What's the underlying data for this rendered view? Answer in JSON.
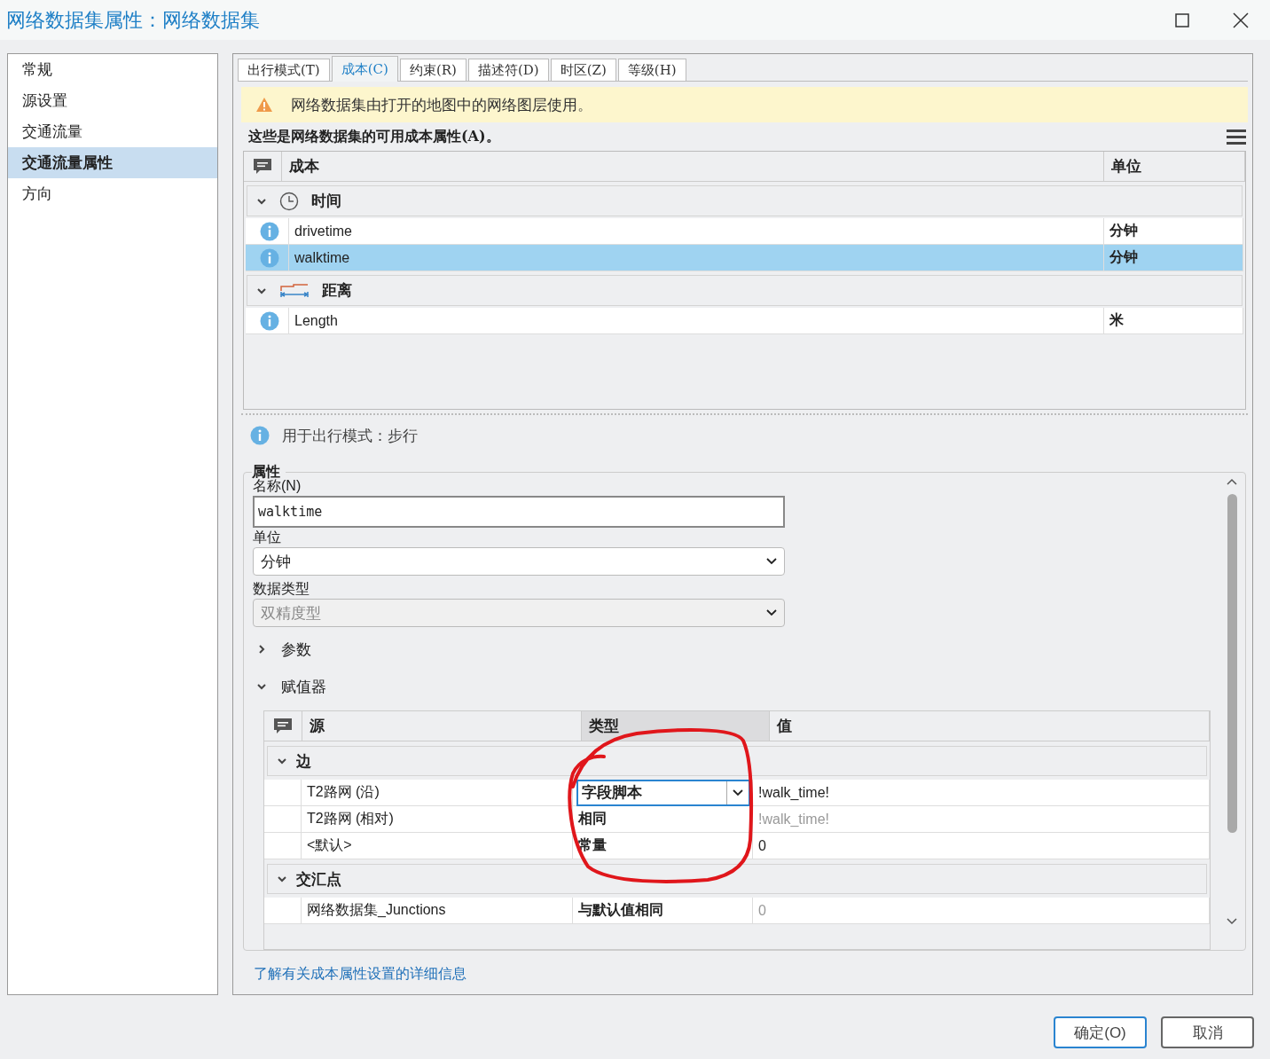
{
  "window": {
    "title": "网络数据集属性：网络数据集"
  },
  "sidebar": {
    "items": [
      {
        "label": "常规",
        "selected": false
      },
      {
        "label": "源设置",
        "selected": false
      },
      {
        "label": "交通流量",
        "selected": false
      },
      {
        "label": "交通流量属性",
        "selected": true
      },
      {
        "label": "方向",
        "selected": false
      }
    ]
  },
  "tabs": [
    {
      "label": "出行模式(T)",
      "selected": false
    },
    {
      "label": "成本(C)",
      "selected": true
    },
    {
      "label": "约束(R)",
      "selected": false
    },
    {
      "label": "描述符(D)",
      "selected": false
    },
    {
      "label": "时区(Z)",
      "selected": false
    },
    {
      "label": "等级(H)",
      "selected": false
    }
  ],
  "warning": "网络数据集由打开的地图中的网络图层使用。",
  "cost_caption": "这些是网络数据集的可用成本属性(A)。",
  "cost_table": {
    "columns": [
      "成本",
      "单位"
    ],
    "groups": [
      {
        "name": "时间",
        "kind": "time",
        "expanded": true,
        "rows": [
          {
            "name": "drivetime",
            "unit": "分钟",
            "selected": false
          },
          {
            "name": "walktime",
            "unit": "分钟",
            "selected": true
          }
        ]
      },
      {
        "name": "距离",
        "kind": "distance",
        "expanded": true,
        "rows": [
          {
            "name": "Length",
            "unit": "米",
            "selected": false
          }
        ]
      }
    ]
  },
  "usage_note": "用于出行模式：步行",
  "properties": {
    "legend": "属性",
    "name_label": "名称(N)",
    "name_value": "walktime",
    "unit_label": "单位",
    "unit_value": "分钟",
    "data_type_label": "数据类型",
    "data_type_value": "双精度型",
    "data_type_disabled": true,
    "sections": [
      {
        "label": "参数",
        "expanded": false
      },
      {
        "label": "赋值器",
        "expanded": true
      }
    ]
  },
  "evaluators": {
    "columns": [
      "源",
      "类型",
      "值"
    ],
    "groups": [
      {
        "name": "边",
        "expanded": true,
        "rows": [
          {
            "source": "T2路网 (沿)",
            "type": "字段脚本",
            "value": "!walk_time!",
            "editing": true,
            "inherited": false
          },
          {
            "source": "T2路网 (相对)",
            "type": "相同",
            "value": "!walk_time!",
            "editing": false,
            "inherited": true
          },
          {
            "source": "<默认>",
            "type": "常量",
            "value": "0",
            "editing": false,
            "inherited": false
          }
        ]
      },
      {
        "name": "交汇点",
        "expanded": true,
        "rows": [
          {
            "source": "网络数据集_Junctions",
            "type": "与默认值相同",
            "value": "0",
            "editing": false,
            "inherited": true
          }
        ]
      }
    ]
  },
  "help_link": "了解有关成本属性设置的详细信息",
  "buttons": [
    {
      "label": "确定(O)",
      "kind": "primary"
    },
    {
      "label": "取消",
      "kind": "secondary"
    }
  ]
}
